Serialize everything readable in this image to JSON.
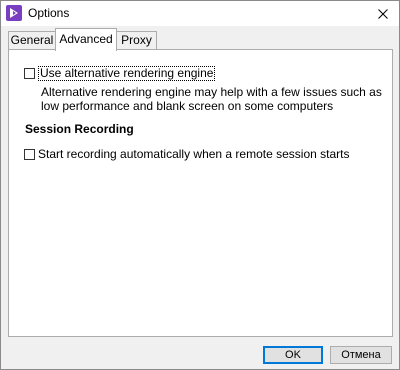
{
  "window": {
    "title": "Options"
  },
  "tabs": [
    {
      "label": "General"
    },
    {
      "label": "Advanced"
    },
    {
      "label": "Proxy"
    }
  ],
  "advanced": {
    "alt_rendering_label": "Use alternative rendering engine",
    "alt_rendering_checked": false,
    "alt_rendering_description": "Alternative rendering engine may help with a few issues such as low performance and blank screen on some computers",
    "session_recording_title": "Session Recording",
    "auto_record_label": "Start recording automatically when a remote session starts",
    "auto_record_checked": false
  },
  "buttons": {
    "ok_label": "OK",
    "cancel_label": "Отмена"
  },
  "colors": {
    "app_icon": "#7a3fc0",
    "default_button_border": "#0078d7"
  },
  "icons": {
    "app": "app-logo-icon",
    "close": "close-icon"
  }
}
